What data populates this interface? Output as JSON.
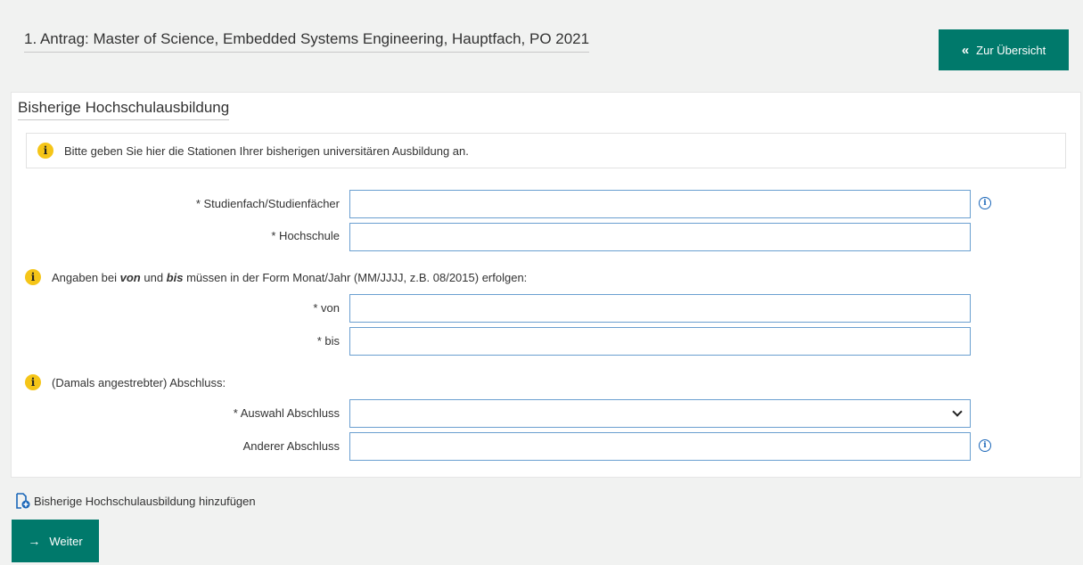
{
  "header": {
    "title": "1. Antrag: Master of Science, Embedded Systems Engineering, Hauptfach, PO 2021",
    "overview_button": {
      "label": "Zur Übersicht",
      "icon": "double-chevron-left-icon"
    }
  },
  "section": {
    "title": "Bisherige Hochschulausbildung",
    "info": "Bitte geben Sie hier die Stationen Ihrer bisherigen universitären Ausbildung an.",
    "fields": {
      "studienfach": {
        "label": "* Studienfach/Studienfächer",
        "value": ""
      },
      "hochschule": {
        "label": "* Hochschule",
        "value": ""
      },
      "von": {
        "label": "* von",
        "value": ""
      },
      "bis": {
        "label": "* bis",
        "value": ""
      },
      "auswahl_abschluss": {
        "label": "* Auswahl Abschluss",
        "value": ""
      },
      "anderer_abschluss": {
        "label": "Anderer Abschluss",
        "value": ""
      }
    },
    "date_note": {
      "prefix": "Angaben bei ",
      "von": "von",
      "middle": " und ",
      "bis": "bis",
      "suffix": " müssen in der Form Monat/Jahr (MM/JJJJ, z.B. 08/2015) erfolgen:"
    },
    "degree_note": "(Damals angestrebter) Abschluss:"
  },
  "actions": {
    "add_label": "Bisherige Hochschulausbildung hinzufügen",
    "next_label": "Weiter"
  },
  "colors": {
    "primary": "#00796b",
    "info_icon": "#f5c518",
    "help_icon": "#1a66b8",
    "input_border": "#6a9fd0",
    "background": "#f1f2f1"
  }
}
